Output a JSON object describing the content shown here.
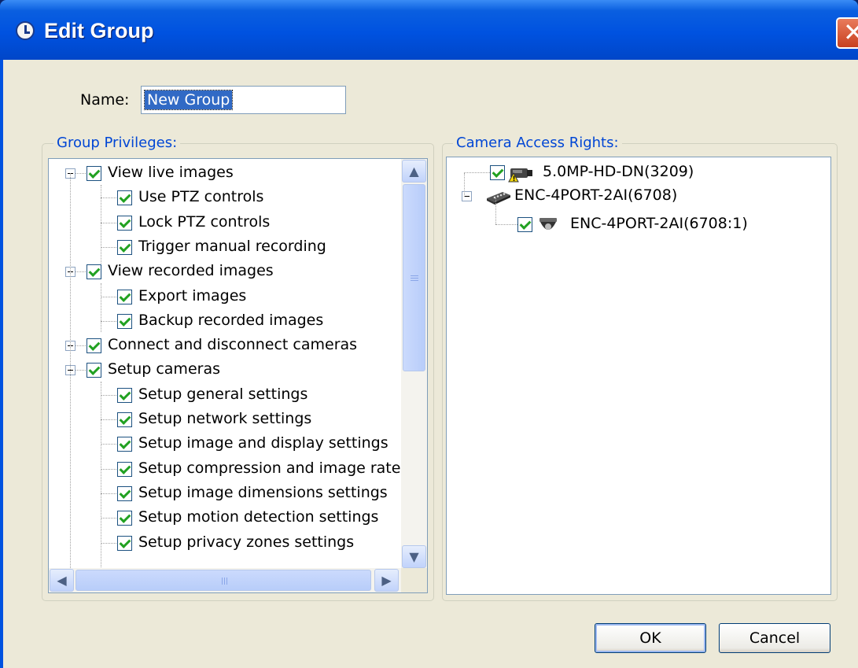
{
  "window": {
    "title": "Edit Group"
  },
  "name_field": {
    "label": "Name:",
    "value": "New Group"
  },
  "group_privileges": {
    "legend": "Group Privileges:",
    "items": [
      {
        "label": "View live images",
        "level": 0
      },
      {
        "label": "Use PTZ controls",
        "level": 1
      },
      {
        "label": "Lock PTZ controls",
        "level": 1
      },
      {
        "label": "Trigger manual recording",
        "level": 1
      },
      {
        "label": "View recorded images",
        "level": 0
      },
      {
        "label": "Export images",
        "level": 1
      },
      {
        "label": "Backup recorded images",
        "level": 1
      },
      {
        "label": "Connect and disconnect cameras",
        "level": 0
      },
      {
        "label": "Setup cameras",
        "level": 0
      },
      {
        "label": "Setup general settings",
        "level": 1
      },
      {
        "label": "Setup network settings",
        "level": 1
      },
      {
        "label": "Setup image and display settings",
        "level": 1
      },
      {
        "label": "Setup compression and image rate",
        "level": 1
      },
      {
        "label": "Setup image dimensions settings",
        "level": 1
      },
      {
        "label": "Setup motion detection settings",
        "level": 1
      },
      {
        "label": "Setup privacy zones settings",
        "level": 1
      }
    ]
  },
  "camera_access": {
    "legend": "Camera Access Rights:",
    "items": [
      {
        "label": "5.0MP-HD-DN(3209)",
        "icon": "box-camera-warning-icon"
      },
      {
        "label": "ENC-4PORT-2AI(6708)",
        "icon": "encoder-icon"
      },
      {
        "label": "ENC-4PORT-2AI(6708:1)",
        "icon": "dome-camera-icon"
      }
    ]
  },
  "buttons": {
    "ok": "OK",
    "cancel": "Cancel"
  },
  "colors": {
    "title_bar": "#0052e0",
    "dialog_bg": "#ece9d8",
    "legend": "#0046d5",
    "check": "#21a121",
    "selection": "#316ac5"
  }
}
